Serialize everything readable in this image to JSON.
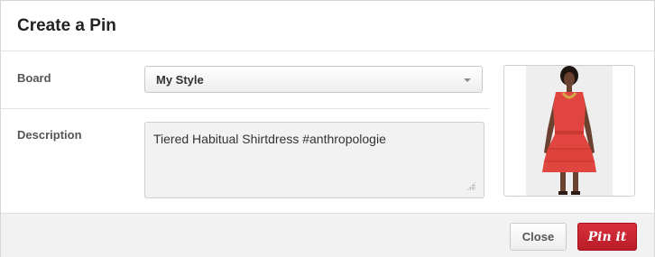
{
  "dialog": {
    "title": "Create a Pin"
  },
  "board": {
    "label": "Board",
    "selected": "My Style"
  },
  "description": {
    "label": "Description",
    "value": "Tiered Habitual Shirtdress #anthropologie"
  },
  "pin_image": {
    "subject": "woman wearing red tiered shirtdress",
    "dress_color": "#e0463f"
  },
  "footer": {
    "close_label": "Close",
    "pin_label": "Pin it"
  },
  "colors": {
    "accent": "#c8202c"
  }
}
